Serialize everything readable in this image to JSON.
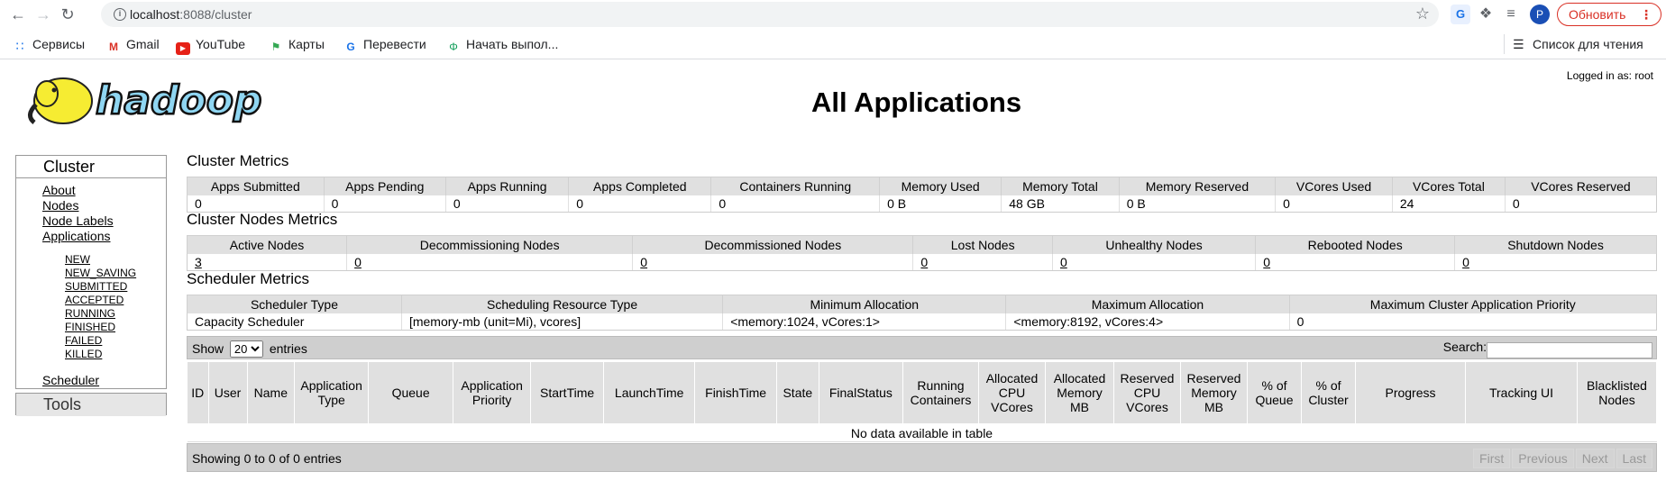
{
  "browser": {
    "url_host": "localhost",
    "url_rest": ":8088/cluster",
    "update_label": "Обновить",
    "avatar_letter": "P",
    "bookmarks": [
      {
        "label": "Сервисы",
        "icon": "apps-grid-icon"
      },
      {
        "label": "Gmail",
        "icon": "gmail-icon"
      },
      {
        "label": "YouTube",
        "icon": "youtube-icon"
      },
      {
        "label": "Карты",
        "icon": "maps-icon"
      },
      {
        "label": "Перевести",
        "icon": "translate-icon"
      },
      {
        "label": "Начать выпол...",
        "icon": "phi-icon"
      }
    ],
    "reading_list": "Список для чтения"
  },
  "header": {
    "logo_text": "hadoop",
    "title": "All Applications",
    "logged_in": "Logged in as: root"
  },
  "sidebar": {
    "cluster_label": "Cluster",
    "links": [
      "About",
      "Nodes",
      "Node Labels",
      "Applications"
    ],
    "app_states": [
      "NEW",
      "NEW_SAVING",
      "SUBMITTED",
      "ACCEPTED",
      "RUNNING",
      "FINISHED",
      "FAILED",
      "KILLED"
    ],
    "scheduler": "Scheduler",
    "tools_label": "Tools"
  },
  "cluster_metrics": {
    "title": "Cluster Metrics",
    "headers": [
      "Apps Submitted",
      "Apps Pending",
      "Apps Running",
      "Apps Completed",
      "Containers Running",
      "Memory Used",
      "Memory Total",
      "Memory Reserved",
      "VCores Used",
      "VCores Total",
      "VCores Reserved"
    ],
    "values": [
      "0",
      "0",
      "0",
      "0",
      "0",
      "0 B",
      "48 GB",
      "0 B",
      "0",
      "24",
      "0"
    ]
  },
  "node_metrics": {
    "title": "Cluster Nodes Metrics",
    "headers": [
      "Active Nodes",
      "Decommissioning Nodes",
      "Decommissioned Nodes",
      "Lost Nodes",
      "Unhealthy Nodes",
      "Rebooted Nodes",
      "Shutdown Nodes"
    ],
    "values": [
      "3",
      "0",
      "0",
      "0",
      "0",
      "0",
      "0"
    ]
  },
  "scheduler_metrics": {
    "title": "Scheduler Metrics",
    "headers": [
      "Scheduler Type",
      "Scheduling Resource Type",
      "Minimum Allocation",
      "Maximum Allocation",
      "Maximum Cluster Application Priority"
    ],
    "values": [
      "Capacity Scheduler",
      "[memory-mb (unit=Mi), vcores]",
      "<memory:1024, vCores:1>",
      "<memory:8192, vCores:4>",
      "0"
    ]
  },
  "apps": {
    "show_label": "Show",
    "page_size": "20",
    "entries_label": "entries",
    "search_label": "Search:",
    "columns": [
      "ID",
      "User",
      "Name",
      "Application Type",
      "Queue",
      "Application Priority",
      "StartTime",
      "LaunchTime",
      "FinishTime",
      "State",
      "FinalStatus",
      "Running Containers",
      "Allocated CPU VCores",
      "Allocated Memory MB",
      "Reserved CPU VCores",
      "Reserved Memory MB",
      "% of Queue",
      "% of Cluster",
      "Progress",
      "Tracking UI",
      "Blacklisted Nodes"
    ],
    "empty_message": "No data available in table",
    "info": "Showing 0 to 0 of 0 entries",
    "pager": [
      "First",
      "Previous",
      "Next",
      "Last"
    ]
  }
}
